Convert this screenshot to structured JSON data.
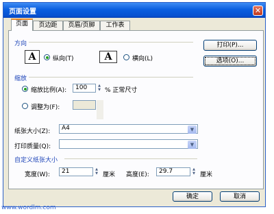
{
  "window": {
    "title": "页面设置",
    "close_symbol": "✕"
  },
  "tabs": [
    {
      "label": "页面"
    },
    {
      "label": "页边距"
    },
    {
      "label": "页眉/页脚"
    },
    {
      "label": "工作表"
    }
  ],
  "orientation": {
    "section_label": "方向",
    "portrait_label": "纵向(T)",
    "landscape_label": "横向(L)",
    "icon_letter": "A",
    "selected": "portrait"
  },
  "buttons": {
    "print": "打印(P)...",
    "options": "选项(O)..."
  },
  "scaling": {
    "section_label": "缩放",
    "scale_label": "缩放比例(A):",
    "scale_value": "100",
    "scale_suffix": "% 正常尺寸",
    "fit_label": "调整为(F):",
    "selected": "scale"
  },
  "paper": {
    "size_label": "纸张大小(Z):",
    "size_value": "A4",
    "quality_label": "打印质量(Q):",
    "quality_value": ""
  },
  "custom_size": {
    "section_label": "自定义纸张大小",
    "width_label": "宽度(W):",
    "width_value": "21",
    "height_label": "高度(E):",
    "height_value": "29.7",
    "unit": "厘米"
  },
  "footer": {
    "ok": "确定",
    "cancel": "取消"
  },
  "watermark": "www.wordlm.com",
  "icons": {
    "spin_up": "▲",
    "spin_down": "▼",
    "dropdown": "▼"
  },
  "colors": {
    "title_bar": "#0a5ee0",
    "section_text": "#1d44b8",
    "radio_dot": "#22a022",
    "active_tab_top": "#e68b2c"
  }
}
